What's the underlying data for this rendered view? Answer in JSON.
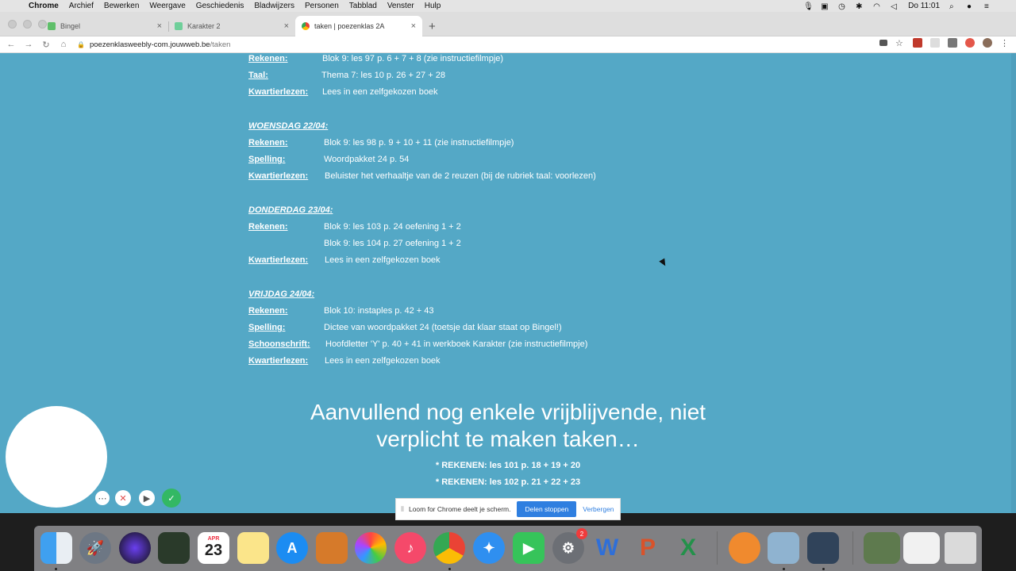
{
  "menubar": {
    "app": "Chrome",
    "items": [
      "Archief",
      "Bewerken",
      "Weergave",
      "Geschiedenis",
      "Bladwijzers",
      "Personen",
      "Tabblad",
      "Venster",
      "Hulp"
    ],
    "clock": "Do 11:01"
  },
  "tabs": [
    {
      "title": "Bingel",
      "close": "×"
    },
    {
      "title": "Karakter 2",
      "close": "×"
    },
    {
      "title": "taken | poezenklas 2A",
      "close": "×"
    }
  ],
  "newtab": "+",
  "toolbar": {
    "url_host": "poezenklasweebly-com.jouwweb.be",
    "url_path": "/taken"
  },
  "schedule": {
    "tuesday": [
      {
        "label": "Rekenen:",
        "value": "Blok 9: les 97 p. 6 + 7 + 8 (zie instructiefilmpje)"
      },
      {
        "label": "Taal:",
        "value": "Thema 7: les 10 p. 26 + 27 + 28"
      },
      {
        "label": "Kwartierlezen:",
        "value": "Lees in een zelfgekozen boek"
      }
    ],
    "wednesday_title": "WOENSDAG 22/04:",
    "wednesday": [
      {
        "label": "Rekenen:",
        "value": "Blok 9: les 98 p. 9 + 10 + 11 (zie instructiefilmpje)"
      },
      {
        "label": "Spelling:",
        "value": "Woordpakket 24 p. 54"
      },
      {
        "label": "Kwartierlezen:",
        "value": "Beluister het verhaaltje van de 2 reuzen (bij de rubriek taal: voorlezen)"
      }
    ],
    "thursday_title": "DONDERDAG 23/04:",
    "thursday": [
      {
        "label": "Rekenen:",
        "value": "Blok 9: les 103 p. 24 oefening 1 + 2"
      },
      {
        "label": "",
        "value": "Blok 9: les 104 p. 27 oefening 1 + 2"
      },
      {
        "label": "Kwartierlezen:",
        "value": "Lees in een zelfgekozen boek"
      }
    ],
    "friday_title": "VRIJDAG 24/04:",
    "friday": [
      {
        "label": "Rekenen:",
        "value": "Blok 10: instaples p. 42 + 43"
      },
      {
        "label": "Spelling:",
        "value": "Dictee van woordpakket 24 (toetsje dat klaar staat op Bingel!)"
      },
      {
        "label": "Schoonschrift:",
        "value": "Hoofdletter 'Y' p. 40 + 41 in werkboek Karakter (zie instructiefilmpje)"
      },
      {
        "label": "Kwartierlezen:",
        "value": "Lees in een zelfgekozen boek"
      }
    ]
  },
  "extra": {
    "heading": "Aanvullend nog enkele vrijblijvende, niet verplicht te maken taken…",
    "items": [
      "* REKENEN: les 101 p. 18 + 19 + 20",
      "* REKENEN: les 102 p. 21 + 22 + 23"
    ]
  },
  "loom": {
    "message": "Loom for Chrome deelt je scherm.",
    "stop_label": "Delen stoppen",
    "hide_label": "Verbergen"
  },
  "dock": {
    "calendar_month": "APR",
    "calendar_day": "23",
    "prefs_badge": "2"
  }
}
